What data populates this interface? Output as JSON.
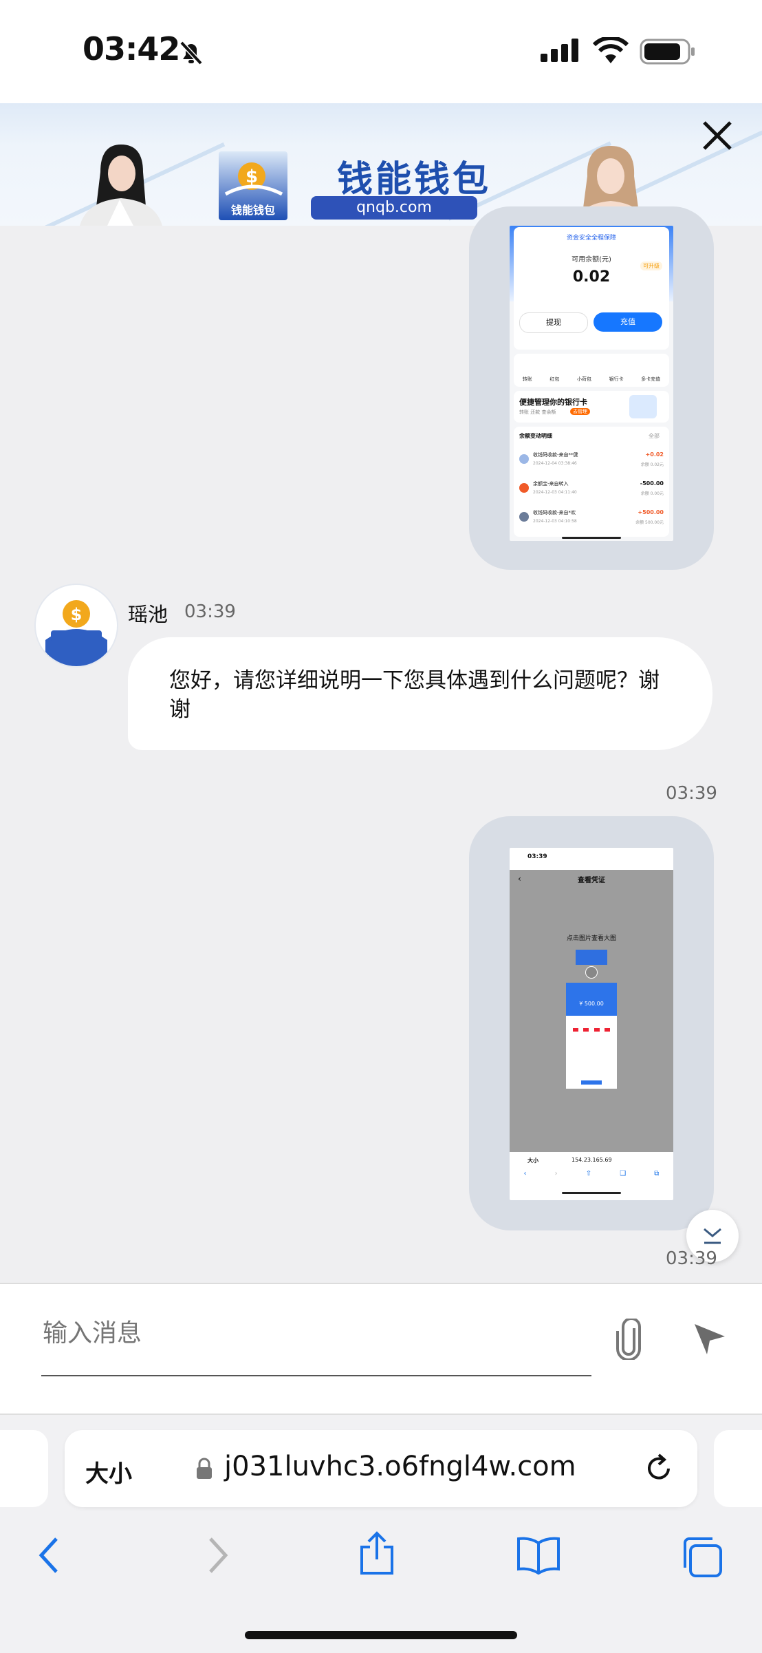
{
  "status_bar": {
    "time": "03:42"
  },
  "banner": {
    "brand_name": "钱能钱包",
    "brand_url": "qnqb.com",
    "logo_text": "钱能钱包"
  },
  "shot1": {
    "security_note": "资金安全全程保障",
    "balance_label": "可用余额(元)",
    "balance": "0.02",
    "tag": "可升级",
    "withdraw": "提现",
    "recharge": "充值",
    "quick_items": [
      "转账",
      "红包",
      "小荷包",
      "银行卡",
      "多卡充值"
    ],
    "bank_promo_title": "便捷管理你的银行卡",
    "bank_promo_sub": "转账 还款 查余额",
    "bank_promo_btn": "去管理",
    "details_title": "余额变动明细",
    "details_all": "全部",
    "rows": [
      {
        "title": "收钱码收款-来自**健",
        "date": "2024-12-04 03:38:46",
        "amount": "+0.02",
        "balance": "余额 0.02元"
      },
      {
        "title": "余额宝-来自转入",
        "date": "2024-12-03 04:11:40",
        "amount": "-500.00",
        "balance": "余额 0.00元"
      },
      {
        "title": "收钱码收款-来自*欢",
        "date": "2024-12-03 04:10:58",
        "amount": "+500.00",
        "balance": "余额 500.00元"
      }
    ]
  },
  "agent_message": {
    "sender": "瑶池",
    "time": "03:39",
    "text": "您好，请您详细说明一下您具体遇到什么问题呢？谢谢"
  },
  "user_message2": {
    "time": "03:39",
    "shot_time": "03:39",
    "shot_title": "查看凭证",
    "shot_hint": "点击图片查看大图",
    "shot_amount": "¥ 500.00",
    "shot_url": "154.23.165.69",
    "shot_aa": "大小"
  },
  "bottom_time": "03:39",
  "input": {
    "placeholder": "输入消息"
  },
  "safari": {
    "aa": "大小",
    "url": "j031luvhc3.o6fngl4w.com"
  }
}
